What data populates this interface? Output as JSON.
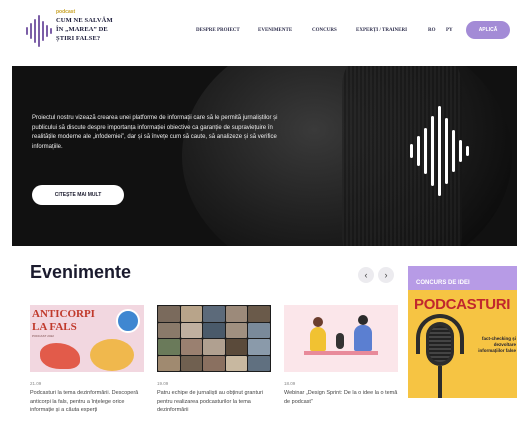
{
  "header": {
    "logo_small": "podcast",
    "logo_lines": [
      "CUM NE SALVĂM",
      "ÎN „MAREA” DE",
      "ȘTIRI FALSE?"
    ],
    "nav": [
      "DESPRE PROIECT",
      "EVENIMENTE",
      "CONCURS",
      "EXPERȚI / TRAINERI",
      "RO",
      "PY"
    ],
    "apply_label": "APLICĂ"
  },
  "hero": {
    "text": "Proiectul nostru vizează crearea unei platforme de informații care să le permită jurnaliștilor și publicului să discute despre importanța informației obiective ca garanție de supraviețuire în realitățile moderne ale „infodemiei”, dar și să învețe cum să caute, să analizeze și să verifice informațiile.",
    "button_label": "CITEȘTE MAI MULT"
  },
  "events": {
    "title": "Evenimente",
    "prev_icon": "‹",
    "next_icon": "›",
    "cards": [
      {
        "date": "21.09",
        "text": "Podcasturi la tema dezinformării. Descoperă anticorpi la fals, pentru a înțelege orice informație și a căuta experți",
        "image_title_1": "ANTICORPI",
        "image_title_2": "LA FALS",
        "image_caption": "PODCAST 2022"
      },
      {
        "date": "19.09",
        "text": "Patru echipe de jurnaliști au obținut granturi pentru realizarea podcasturilor la tema dezinformării"
      },
      {
        "date": "18.09",
        "text": "Webinar „Design Sprint: De la o idee la o temă de podcast”"
      }
    ]
  },
  "promo": {
    "label": "CONCURS DE IDEI",
    "title": "PODCASTURI",
    "subtitle": "fact-checking și dezvoltare informațiilor false"
  },
  "colors": {
    "accent": "#a38bd6",
    "promo_yellow": "#f6c443",
    "promo_red": "#c1272d"
  }
}
